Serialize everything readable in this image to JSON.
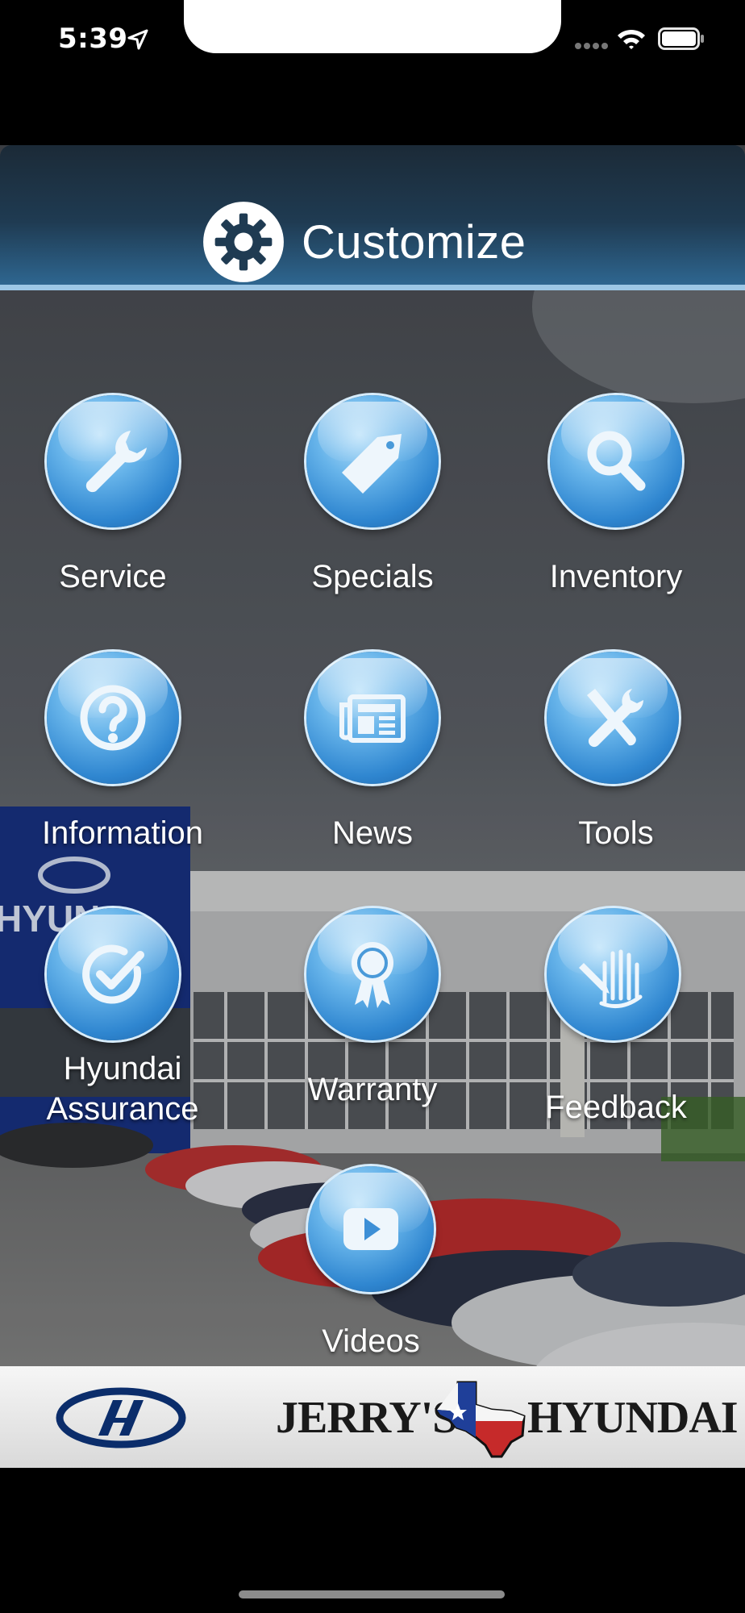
{
  "status_bar": {
    "time": "5:39",
    "icons": [
      "location-arrow-icon",
      "cellular-signal-icon",
      "wifi-icon",
      "battery-icon"
    ]
  },
  "header": {
    "customize_label": "Customize",
    "icon": "gear-icon"
  },
  "menu": {
    "items": [
      {
        "label": "Service",
        "icon": "wrench-icon"
      },
      {
        "label": "Specials",
        "icon": "price-tag-icon"
      },
      {
        "label": "Inventory",
        "icon": "magnifier-icon"
      },
      {
        "label": "Information",
        "icon": "question-icon"
      },
      {
        "label": "News",
        "icon": "newspaper-icon"
      },
      {
        "label": "Tools",
        "icon": "tools-icon"
      },
      {
        "label": "Hyundai Assurance",
        "label_line1": "Hyundai",
        "label_line2": "Assurance",
        "icon": "checkmark-icon"
      },
      {
        "label": "Warranty",
        "icon": "award-ribbon-icon"
      },
      {
        "label": "Feedback",
        "icon": "feedback-hand-icon"
      },
      {
        "label": "Videos",
        "icon": "play-icon"
      }
    ]
  },
  "footer": {
    "brand_logo": "hyundai-logo",
    "dealer_name_part1": "JERRY'S",
    "dealer_name_part2": "HYUNDAI",
    "dealer_emblem": "texas-flag-map-icon"
  },
  "colors": {
    "banner_top": "#1b2a37",
    "banner_bottom": "#2e6690",
    "banner_border": "#9dc7e6",
    "icon_blue": "#2f86d0",
    "hyundai_blue": "#0b2d6b"
  }
}
